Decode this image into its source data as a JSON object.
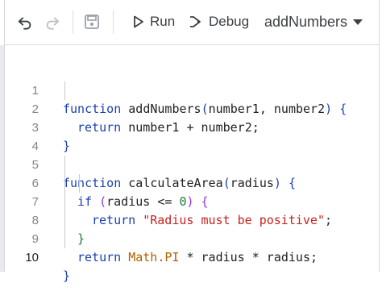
{
  "toolbar": {
    "undo_icon": "undo-icon",
    "redo_icon": "redo-icon",
    "save_icon": "save-icon",
    "run_label": "Run",
    "debug_label": "Debug",
    "function_select": "addNumbers"
  },
  "editor": {
    "line_numbers": [
      "1",
      "2",
      "3",
      "4",
      "5",
      "6",
      "7",
      "8",
      "9",
      "10"
    ],
    "active_line": "10",
    "lines": {
      "l1": {
        "kw": "function",
        "name": "addNumbers",
        "paren_open": "(",
        "params": "number1, number2",
        "paren_close": ")",
        "brace": "{"
      },
      "l2": {
        "kw": "return",
        "expr": "number1 + number2;"
      },
      "l3": {
        "brace": "}"
      },
      "l5": {
        "kw": "function",
        "name": "calculateArea",
        "paren_open": "(",
        "params": "radius",
        "paren_close": ")",
        "brace": "{"
      },
      "l6": {
        "kw": "if",
        "paren_open": "(",
        "cond": "radius <= ",
        "num": "0",
        "paren_close": ")",
        "brace": "{"
      },
      "l7": {
        "kw": "return",
        "string": "\"Radius must be positive\"",
        "semi": ";"
      },
      "l8": {
        "brace": "}"
      },
      "l9": {
        "kw": "return",
        "math": "Math.PI",
        "expr": " * radius * radius;"
      },
      "l10": {
        "brace": "}"
      }
    }
  }
}
